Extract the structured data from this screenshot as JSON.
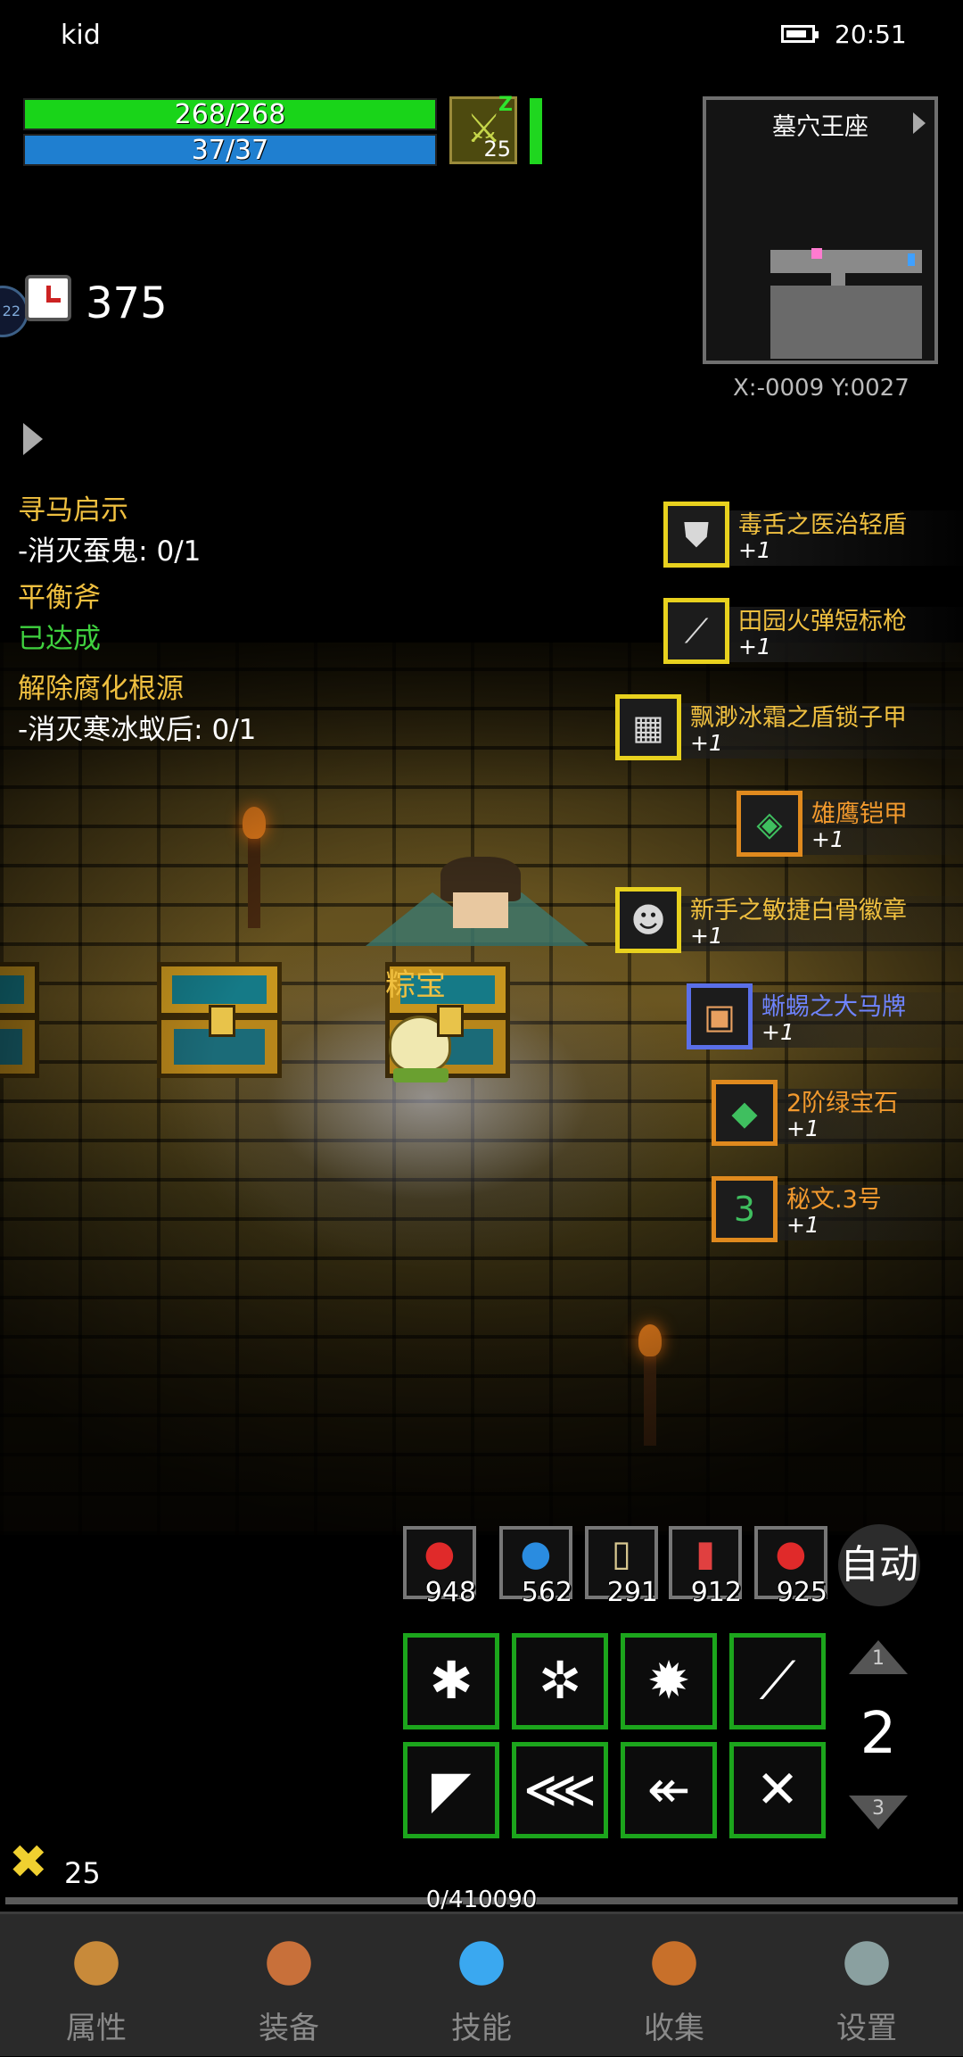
{
  "status_bar": {
    "user": "kid",
    "time": "20:51"
  },
  "player": {
    "hp_text": "268/268",
    "mp_text": "37/37",
    "buff_level": "25",
    "buff_z": "Z",
    "timer_value": "375",
    "edge_badge": "22",
    "level": "25",
    "exp_text": "0/410090",
    "exp_fraction": 0.0
  },
  "quests": [
    {
      "title": "寻马启示",
      "objective": "-消灭蚕鬼: 0/1",
      "status": ""
    },
    {
      "title": "平衡斧",
      "objective": "",
      "status": "已达成"
    },
    {
      "title": "解除腐化根源",
      "objective": "-消灭寒冰蚁后: 0/1",
      "status": ""
    }
  ],
  "minimap": {
    "title": "墓穴王座",
    "coords": "X:-0009  Y:0027"
  },
  "loot_feed": [
    {
      "name": "毒舌之医治轻盾",
      "count": "+1",
      "color": "#f0c040",
      "frame": "yellow",
      "icon": "shield-icon",
      "glyph": "⛊"
    },
    {
      "name": "田园火弹短标枪",
      "count": "+1",
      "color": "#f0c040",
      "frame": "yellow",
      "icon": "javelin-icon",
      "glyph": "⟋"
    },
    {
      "name": "飘渺冰霜之盾锁子甲",
      "count": "+1",
      "color": "#f0c040",
      "frame": "yellow",
      "icon": "chainmail-icon",
      "glyph": "▦"
    },
    {
      "name": "雄鹰铠甲",
      "count": "+1",
      "color": "#f39a2e",
      "frame": "orange",
      "icon": "armor-icon",
      "glyph": "◈"
    },
    {
      "name": "新手之敏捷白骨徽章",
      "count": "+1",
      "color": "#f0c040",
      "frame": "yellow",
      "icon": "badge-icon",
      "glyph": "☻"
    },
    {
      "name": "蜥蜴之大马牌",
      "count": "+1",
      "color": "#6f84ff",
      "frame": "blue",
      "icon": "medallion-icon",
      "glyph": "▣"
    },
    {
      "name": "2阶绿宝石",
      "count": "+1",
      "color": "#f39a2e",
      "frame": "orange",
      "icon": "emerald-icon",
      "glyph": "◆"
    },
    {
      "name": "秘文.3号",
      "count": "+1",
      "color": "#f39a2e",
      "frame": "orange",
      "icon": "rune-stone-icon",
      "glyph": "3"
    }
  ],
  "pet": {
    "name": "粽宝"
  },
  "consumables": [
    {
      "count": "948",
      "icon": "red-potion-icon",
      "color": "#e02a2a",
      "glyph": "●"
    },
    {
      "count": "562",
      "icon": "blue-potion-icon",
      "color": "#2a8ce0",
      "glyph": "●"
    },
    {
      "count": "291",
      "icon": "scroll-icon",
      "color": "#d8c890",
      "glyph": "▯"
    },
    {
      "count": "912",
      "icon": "vial-icon",
      "color": "#e04040",
      "glyph": "▮"
    },
    {
      "count": "925",
      "icon": "meat-icon",
      "color": "#e02a2a",
      "glyph": "●"
    }
  ],
  "auto_label": "自动",
  "skills": [
    {
      "icon": "spider-skill-icon",
      "glyph": "✱"
    },
    {
      "icon": "bug-skill-icon",
      "glyph": "✲"
    },
    {
      "icon": "crab-skill-icon",
      "glyph": "✹"
    },
    {
      "icon": "blade-skill-icon",
      "glyph": "⟋"
    },
    {
      "icon": "slash-skill-icon",
      "glyph": "◤"
    },
    {
      "icon": "dash-skill-icon",
      "glyph": "⋘"
    },
    {
      "icon": "arrow-skill-icon",
      "glyph": "↞"
    },
    {
      "icon": "crossed-swords-skill-icon",
      "glyph": "✕"
    }
  ],
  "skill_pages": {
    "up": "1",
    "current": "2",
    "down": "3"
  },
  "nav": [
    {
      "label": "属性",
      "icon": "helmet-icon",
      "color": "#c88a3a"
    },
    {
      "label": "装备",
      "icon": "bag-icon",
      "color": "#c8703a"
    },
    {
      "label": "技能",
      "icon": "crystal-icon",
      "color": "#3aa8f0"
    },
    {
      "label": "收集",
      "icon": "book-icon",
      "color": "#c8702a"
    },
    {
      "label": "设置",
      "icon": "gear-icon",
      "color": "#8aa0a0"
    }
  ]
}
